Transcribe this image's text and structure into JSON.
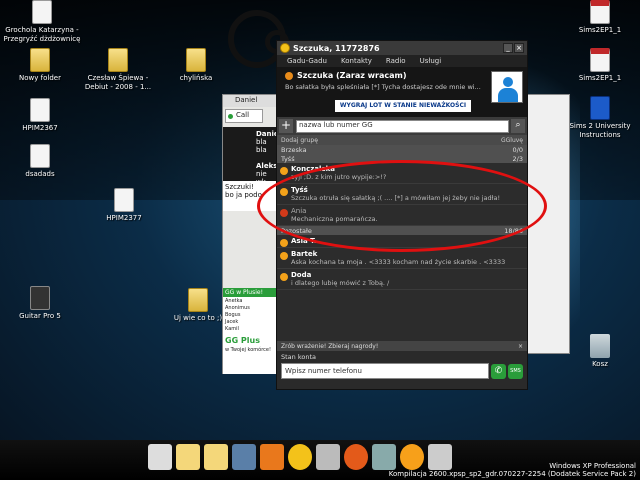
{
  "desktop": {
    "icons": [
      {
        "label": "Grochola Katarzyna - Przegryźć dżdżownicę",
        "icon": "document-icon"
      },
      {
        "label": "Nowy folder",
        "icon": "folder-icon"
      },
      {
        "label": "Czesław Śpiewa - Debiut - 2008 - 1...",
        "icon": "folder-icon"
      },
      {
        "label": "chylińska",
        "icon": "folder-icon"
      },
      {
        "label": "HPIM2367",
        "icon": "image-icon"
      },
      {
        "label": "dsadads",
        "icon": "document-icon"
      },
      {
        "label": "HPIM2377",
        "icon": "image-icon"
      },
      {
        "label": "Guitar Pro 5",
        "icon": "guitar-pro-icon"
      },
      {
        "label": "Uj wie co to ;)",
        "icon": "folder-icon"
      },
      {
        "label": "Sims2EP1_1",
        "icon": "pdf-icon"
      },
      {
        "label": "Sims2EP1_1",
        "icon": "pdf-icon"
      },
      {
        "label": "Sims 2 University Instructions",
        "icon": "document-icon"
      },
      {
        "label": "Kosz",
        "icon": "recycle-bin-icon"
      }
    ]
  },
  "bg_windows": {
    "left_chat": {
      "title": "Daniel",
      "call_label": "Call",
      "contact1_name": "Daniel",
      "contact1_text": "bla bla",
      "contact2_name": "Aleks",
      "contact2_text": "nie wk",
      "msg1": "Szczuki!",
      "msg2": "bo ja podo",
      "promo_title": "GG w Plusie!",
      "promo_items": [
        "Anetka",
        "Anonimus",
        "Bogus",
        "Jacek",
        "Kamil"
      ],
      "ggplus_title": "GG Plus",
      "ggplus_sub": "w Twojej komórce!"
    }
  },
  "gg": {
    "window_title": "Szczuka, 11772876",
    "menu": [
      "Gadu-Gadu",
      "Kontakty",
      "Radio",
      "Usługi"
    ],
    "status_title": "Szczuka (Zaraz wracam)",
    "description": "Bo sałatka była spleśniała [*] Tycha dostajesz ode mnie wi...",
    "ad_text": "WYGRAJ LOT W STANIE NIEWAŻKOŚCI",
    "search_placeholder": "nazwa lub numer GG",
    "add_group": "Dodaj grupę",
    "view_toggle": "GGluvę",
    "groups": [
      {
        "name": "Brzeska",
        "count": "0/0"
      },
      {
        "name": "Tyśś",
        "count": "2/3"
      }
    ],
    "contacts": [
      {
        "name": "Konczalska",
        "desc": "zyji ;D. z kim jutro wypije:>!?",
        "status": "busy"
      },
      {
        "name": "Tyśś",
        "desc": "Szczuka otruła się sałatką ;( .... [*] a mówiłam jej żeby nie jadła!",
        "status": "busy"
      },
      {
        "name": "Ania",
        "desc": "Mechaniczna pomarańcza.",
        "status": "away"
      }
    ],
    "group3": {
      "name": "Pozostałe",
      "count": "18/86"
    },
    "contacts2": [
      {
        "name": "Asia T.",
        "desc": "",
        "status": "busy"
      },
      {
        "name": "Bartek",
        "desc": "Aska kochana ta moja . <3333 kocham nad życie skarbie . <3333",
        "status": "busy"
      },
      {
        "name": "Doda",
        "desc": "i dlatego lubię mówić z Tobą. /",
        "status": "busy"
      }
    ],
    "promo": "Zrób wrażenie! Zbieraj nagrody!",
    "stan_konta": "Stan konta",
    "phone_placeholder": "Wpisz numer telefonu",
    "sms_label": "SMS"
  },
  "taskbar": {
    "version_line1": "Windows XP Professional",
    "version_line2": "Kompilacja 2600.xpsp_sp2_gdr.070227-2254 (Dodatek Service Pack 2)"
  }
}
